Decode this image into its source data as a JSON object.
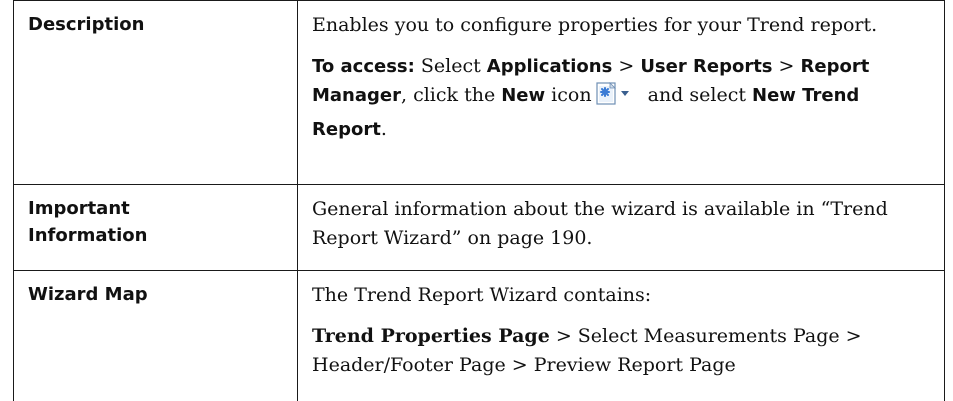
{
  "rows": [
    {
      "header": "Description",
      "desc_text": "Enables you to configure properties for your Trend report.",
      "access": {
        "label": "To access:",
        "t1": " Select ",
        "applications": "Applications",
        "sep1": " > ",
        "user_reports": "User Reports",
        "sep2": " > ",
        "report_manager": "Report Manager",
        "t2": ", click the ",
        "new": "New",
        "t3": " icon",
        "t4": " and select ",
        "new_trend_report": "New Trend Report",
        "t5": "."
      }
    },
    {
      "header_line1": "Important",
      "header_line2": "Information",
      "text": "General information about the wizard is available in “Trend Report Wizard” on page 190."
    },
    {
      "header": "Wizard Map",
      "intro": "The Trend Report Wizard contains:",
      "current_page": "Trend Properties Page",
      "sep": " > ",
      "page2": "Select Measurements Page",
      "page3": "Header/Footer Page",
      "page4": "Preview Report Page"
    }
  ],
  "icons": {
    "new_icon": "new-document-dropdown-icon"
  }
}
